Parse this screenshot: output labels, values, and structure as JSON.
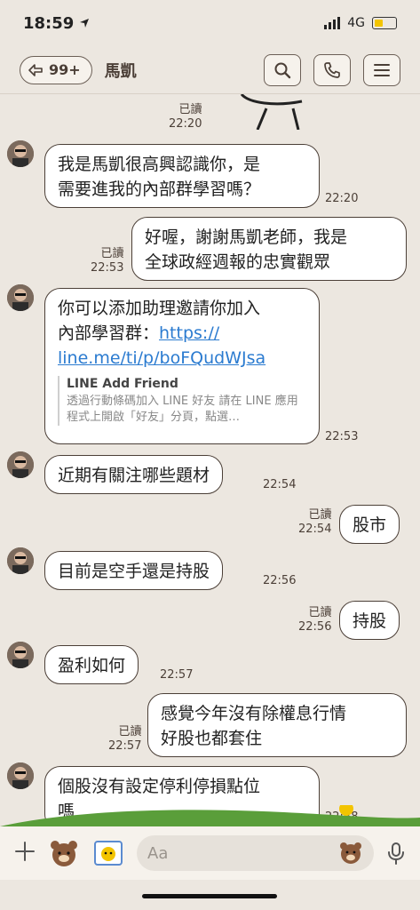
{
  "status_bar": {
    "time": "18:59",
    "network": "4G"
  },
  "header": {
    "back_count": "99+",
    "title": "馬凱"
  },
  "messages": [
    {
      "side": "me",
      "read": "已讀",
      "time": "22:20"
    },
    {
      "side": "them",
      "lines": [
        "我是馬凱很高興認識你，是",
        "需要進我的內部群學習嗎？"
      ],
      "time": "22:20"
    },
    {
      "side": "me",
      "read": "已讀",
      "lines": [
        "好喔，謝謝馬凱老師，我是",
        "全球政經週報的忠實觀眾"
      ],
      "time": "22:53"
    },
    {
      "side": "them",
      "lines": [
        "你可以添加助理邀請你加入",
        "內部學習群："
      ],
      "link": [
        "https://",
        "line.me/ti/p/boFQudWJsa"
      ],
      "preview_title": "LINE Add Friend",
      "preview_text": "透過行動條碼加入 LINE 好友 請在 LINE 應用程式上開啟「好友」分頁，點選…",
      "time": "22:53"
    },
    {
      "side": "them",
      "lines": [
        "近期有關注哪些題材"
      ],
      "time": "22:54"
    },
    {
      "side": "me",
      "read": "已讀",
      "lines": [
        "股市"
      ],
      "time": "22:54"
    },
    {
      "side": "them",
      "lines": [
        "目前是空手還是持股"
      ],
      "time": "22:56"
    },
    {
      "side": "me",
      "read": "已讀",
      "lines": [
        "持股"
      ],
      "time": "22:56"
    },
    {
      "side": "them",
      "lines": [
        "盈利如何"
      ],
      "time": "22:57"
    },
    {
      "side": "me",
      "read": "已讀",
      "lines": [
        "感覺今年沒有除權息行情",
        "好股也都套住"
      ],
      "time": "22:57"
    },
    {
      "side": "them",
      "lines": [
        "個股沒有設定停利停損點位",
        "嗎"
      ],
      "time": "22:58"
    }
  ],
  "input": {
    "placeholder": "Aa"
  }
}
